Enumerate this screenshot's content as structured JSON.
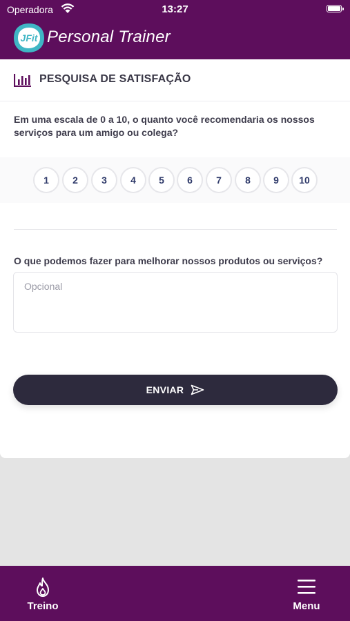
{
  "status_bar": {
    "carrier": "Operadora",
    "time": "13:27"
  },
  "app_bar": {
    "logo_mark": "JFit",
    "logo_text": "Personal Trainer",
    "colors": {
      "background": "#5d0e5c",
      "logo_teal": "#3fb6c5"
    }
  },
  "survey": {
    "icon": "bar-chart-icon",
    "title": "PESQUISA DE SATISFAÇÃO",
    "question_nps": "Em uma escala de 0 a 10, o quanto você recomendaria os nossos serviços para um amigo ou colega?",
    "ratings": [
      "1",
      "2",
      "3",
      "4",
      "5",
      "6",
      "7",
      "8",
      "9",
      "10"
    ],
    "question_feedback": "O que podemos fazer para melhorar nossos produtos ou serviços?",
    "feedback_placeholder": "Opcional",
    "feedback_value": "",
    "submit_label": "ENVIAR",
    "submit_icon": "send-icon"
  },
  "bottom_nav": {
    "items": [
      {
        "label": "Treino",
        "icon": "flame-icon"
      },
      {
        "label": "Menu",
        "icon": "hamburger-menu-icon"
      }
    ]
  }
}
